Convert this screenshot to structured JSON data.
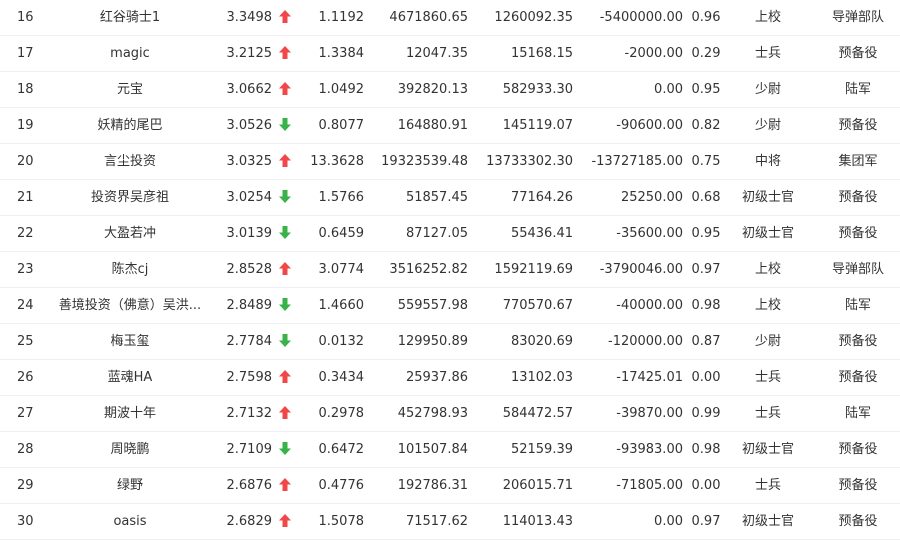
{
  "colors": {
    "up": "#f04848",
    "down": "#39b24a",
    "text": "#333333",
    "divider": "#eef0f3"
  },
  "rows": [
    {
      "rank": "16",
      "name": "红谷骑士1",
      "score": "3.3498",
      "trend": "up",
      "r1": "1.1192",
      "r2": "4671860.65",
      "r3": "1260092.35",
      "r4": "-5400000.00",
      "r5": "0.96",
      "level": "上校",
      "unit": "导弹部队"
    },
    {
      "rank": "17",
      "name": "magic",
      "score": "3.2125",
      "trend": "up",
      "r1": "1.3384",
      "r2": "12047.35",
      "r3": "15168.15",
      "r4": "-2000.00",
      "r5": "0.29",
      "level": "士兵",
      "unit": "预备役"
    },
    {
      "rank": "18",
      "name": "元宝",
      "score": "3.0662",
      "trend": "up",
      "r1": "1.0492",
      "r2": "392820.13",
      "r3": "582933.30",
      "r4": "0.00",
      "r5": "0.95",
      "level": "少尉",
      "unit": "陆军"
    },
    {
      "rank": "19",
      "name": "妖精的尾巴",
      "score": "3.0526",
      "trend": "down",
      "r1": "0.8077",
      "r2": "164880.91",
      "r3": "145119.07",
      "r4": "-90600.00",
      "r5": "0.82",
      "level": "少尉",
      "unit": "预备役"
    },
    {
      "rank": "20",
      "name": "言尘投资",
      "score": "3.0325",
      "trend": "up",
      "r1": "13.3628",
      "r2": "19323539.48",
      "r3": "13733302.30",
      "r4": "-13727185.00",
      "r5": "0.75",
      "level": "中将",
      "unit": "集团军"
    },
    {
      "rank": "21",
      "name": "投资界吴彦祖",
      "score": "3.0254",
      "trend": "down",
      "r1": "1.5766",
      "r2": "51857.45",
      "r3": "77164.26",
      "r4": "25250.00",
      "r5": "0.68",
      "level": "初级士官",
      "unit": "预备役"
    },
    {
      "rank": "22",
      "name": "大盈若冲",
      "score": "3.0139",
      "trend": "down",
      "r1": "0.6459",
      "r2": "87127.05",
      "r3": "55436.41",
      "r4": "-35600.00",
      "r5": "0.95",
      "level": "初级士官",
      "unit": "预备役"
    },
    {
      "rank": "23",
      "name": "陈杰cj",
      "score": "2.8528",
      "trend": "up",
      "r1": "3.0774",
      "r2": "3516252.82",
      "r3": "1592119.69",
      "r4": "-3790046.00",
      "r5": "0.97",
      "level": "上校",
      "unit": "导弹部队"
    },
    {
      "rank": "24",
      "name": "善境投资（佛意）吴洪...",
      "score": "2.8489",
      "trend": "down",
      "r1": "1.4660",
      "r2": "559557.98",
      "r3": "770570.67",
      "r4": "-40000.00",
      "r5": "0.98",
      "level": "上校",
      "unit": "陆军"
    },
    {
      "rank": "25",
      "name": "梅玉玺",
      "score": "2.7784",
      "trend": "down",
      "r1": "0.0132",
      "r2": "129950.89",
      "r3": "83020.69",
      "r4": "-120000.00",
      "r5": "0.87",
      "level": "少尉",
      "unit": "预备役"
    },
    {
      "rank": "26",
      "name": "蓝魂HA",
      "score": "2.7598",
      "trend": "up",
      "r1": "0.3434",
      "r2": "25937.86",
      "r3": "13102.03",
      "r4": "-17425.01",
      "r5": "0.00",
      "level": "士兵",
      "unit": "预备役"
    },
    {
      "rank": "27",
      "name": "期波十年",
      "score": "2.7132",
      "trend": "up",
      "r1": "0.2978",
      "r2": "452798.93",
      "r3": "584472.57",
      "r4": "-39870.00",
      "r5": "0.99",
      "level": "士兵",
      "unit": "陆军"
    },
    {
      "rank": "28",
      "name": "周晓鹏",
      "score": "2.7109",
      "trend": "down",
      "r1": "0.6472",
      "r2": "101507.84",
      "r3": "52159.39",
      "r4": "-93983.00",
      "r5": "0.98",
      "level": "初级士官",
      "unit": "预备役"
    },
    {
      "rank": "29",
      "name": "绿野",
      "score": "2.6876",
      "trend": "up",
      "r1": "0.4776",
      "r2": "192786.31",
      "r3": "206015.71",
      "r4": "-71805.00",
      "r5": "0.00",
      "level": "士兵",
      "unit": "预备役"
    },
    {
      "rank": "30",
      "name": "oasis",
      "score": "2.6829",
      "trend": "up",
      "r1": "1.5078",
      "r2": "71517.62",
      "r3": "114013.43",
      "r4": "0.00",
      "r5": "0.97",
      "level": "初级士官",
      "unit": "预备役"
    }
  ]
}
